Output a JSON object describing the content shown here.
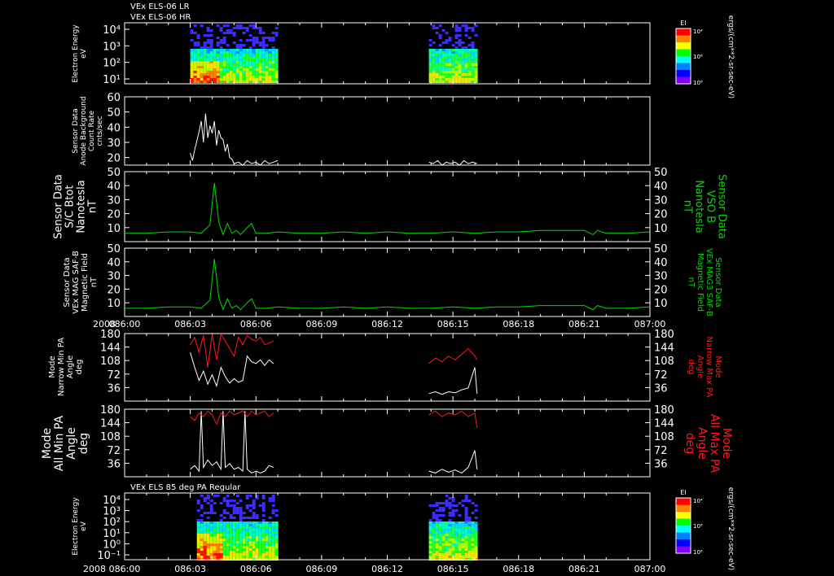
{
  "header": {
    "line1": "VEx ELS-06 LR",
    "line2": "VEx ELS-06 HR",
    "bottom_title": "VEx ELS 85 deg PA Regular"
  },
  "colors": {
    "background": "#000000",
    "axis": "#ffffff",
    "white_trace": "#ffffff",
    "green_trace": "#00dd00",
    "red_trace": "#ff1a1a"
  },
  "time_axis": {
    "year_label": "2008",
    "ticks": [
      "086:00",
      "086:03",
      "086:06",
      "086:09",
      "086:12",
      "086:15",
      "086:18",
      "086:21",
      "087:00"
    ],
    "range_hours": [
      0,
      24
    ]
  },
  "panels": [
    {
      "id": "spec1",
      "ylabel": [
        "Electron Energy",
        "eV"
      ]
    },
    {
      "id": "bg",
      "ylabel": [
        "Sensor Data",
        "Anode Background",
        "Count Rate",
        "cnts/sec"
      ]
    },
    {
      "id": "bvso",
      "ylabel": [
        "Sensor Data",
        "S/C Btot",
        "Nanotesla",
        "nT"
      ],
      "rlabel": [
        "Sensor Data",
        "VSO B",
        "Nanotesla",
        "nT"
      ]
    },
    {
      "id": "bmag",
      "ylabel": [
        "Sensor Data",
        "VEx MAG SAF-B",
        "Magnetic Field",
        "nT"
      ],
      "rlabel": [
        "Sensor Data",
        "VEx MAG3 SAF-B",
        "Magnetic Field",
        "nT"
      ]
    },
    {
      "id": "narrow",
      "ylabel": [
        "Mode",
        "Narrow Min PA",
        "Angle",
        "deg"
      ],
      "rlabel": [
        "Mode",
        "Narrow Max PA",
        "Angle",
        "deg"
      ]
    },
    {
      "id": "all",
      "ylabel": [
        "Mode",
        "All Min PA",
        "Angle",
        "deg"
      ],
      "rlabel": [
        "Mode",
        "All Max PA",
        "Angle",
        "deg"
      ]
    },
    {
      "id": "spec2",
      "ylabel": [
        "Electron Energy",
        "eV"
      ]
    }
  ],
  "colorbar": {
    "label": "EI",
    "ticks_top": [
      "10⁴",
      "10⁶",
      "10⁸"
    ],
    "units": "ergs/(cm**2-sr-sec-eV)"
  },
  "chart_data": [
    {
      "type": "heatmap",
      "title": "VEx ELS-06 LR / VEx ELS-06 HR",
      "xlabel": "",
      "ylabel": "Electron Energy eV",
      "yscale": "log",
      "ytick_labels": [
        "10⁴",
        "10³",
        "10²",
        "10¹"
      ],
      "data_intervals_hours": [
        [
          3.0,
          7.0
        ],
        [
          13.9,
          16.1
        ]
      ]
    },
    {
      "type": "line",
      "ylabel": "Sensor Data Anode Background Count Rate cnts/sec",
      "ylim": [
        15,
        60
      ],
      "yticks": [
        20,
        30,
        40,
        50,
        60
      ],
      "series": [
        {
          "x": [
            3.0,
            3.1,
            3.2,
            3.3,
            3.4,
            3.5,
            3.6,
            3.7,
            3.8,
            3.9,
            4.0,
            4.1,
            4.2,
            4.3,
            4.4,
            4.5,
            4.6,
            4.7,
            4.8,
            4.9,
            5.0,
            5.2,
            5.4,
            5.6,
            5.8,
            6.0,
            6.2,
            6.4,
            6.6,
            6.8,
            7.0
          ],
          "y": [
            23,
            18,
            25,
            31,
            37,
            44,
            30,
            49,
            33,
            41,
            36,
            44,
            28,
            38,
            33,
            32,
            24,
            29,
            20,
            19,
            16,
            17,
            15,
            18,
            16,
            17,
            15,
            18,
            16,
            17,
            18
          ]
        },
        {
          "x": [
            13.9,
            14.1,
            14.3,
            14.5,
            14.7,
            14.9,
            15.1,
            15.3,
            15.5,
            15.7,
            15.9,
            16.1
          ],
          "y": [
            17,
            16,
            18,
            15,
            17,
            16,
            17,
            15,
            18,
            16,
            17,
            16
          ]
        }
      ]
    },
    {
      "type": "line",
      "ylabel": "Sensor Data S/C Btot Nanotesla nT",
      "ylim": [
        0,
        50
      ],
      "yticks": [
        10,
        20,
        30,
        40,
        50
      ],
      "series": [
        {
          "x": [
            0,
            1,
            2,
            3,
            3.5,
            3.9,
            4.1,
            4.3,
            4.5,
            4.7,
            4.9,
            5.1,
            5.3,
            5.6,
            5.8,
            6.0,
            6.5,
            7,
            8,
            9,
            10,
            11,
            12,
            13,
            14,
            15,
            16,
            17,
            18,
            19,
            20,
            21,
            21.4,
            21.6,
            22,
            23,
            24
          ],
          "y": [
            6,
            6,
            7,
            7,
            6,
            12,
            42,
            14,
            5,
            13,
            6,
            8,
            5,
            10,
            13,
            6,
            6,
            7,
            6,
            6,
            7,
            6,
            7,
            6,
            6,
            7,
            6,
            7,
            7,
            8,
            8,
            8,
            5,
            8,
            6,
            6,
            7
          ]
        }
      ]
    },
    {
      "type": "line",
      "ylabel": "Sensor Data VEx MAG SAF-B Magnetic Field nT",
      "ylim": [
        0,
        50
      ],
      "yticks": [
        10,
        20,
        30,
        40,
        50
      ],
      "series": [
        {
          "x": [
            0,
            1,
            2,
            3,
            3.5,
            3.9,
            4.1,
            4.3,
            4.5,
            4.7,
            4.9,
            5.1,
            5.3,
            5.6,
            5.8,
            6.0,
            6.5,
            7,
            8,
            9,
            10,
            11,
            12,
            13,
            14,
            15,
            16,
            17,
            18,
            19,
            20,
            21,
            21.4,
            21.6,
            22,
            23,
            24
          ],
          "y": [
            6,
            6,
            7,
            7,
            6,
            12,
            42,
            14,
            5,
            13,
            6,
            8,
            5,
            10,
            13,
            6,
            6,
            7,
            6,
            6,
            7,
            6,
            7,
            6,
            6,
            7,
            6,
            7,
            7,
            8,
            8,
            8,
            5,
            8,
            6,
            6,
            7
          ]
        }
      ]
    },
    {
      "type": "line",
      "ylabel": "Mode Narrow Min PA Angle deg",
      "ylim": [
        0,
        180
      ],
      "yticks": [
        36,
        72,
        108,
        144,
        180
      ],
      "series": [
        {
          "name": "Min PA",
          "x": [
            3.0,
            3.2,
            3.4,
            3.6,
            3.8,
            4.0,
            4.2,
            4.4,
            4.6,
            4.8,
            5.0,
            5.2,
            5.4,
            5.6,
            5.8,
            6.0,
            6.2,
            6.4,
            6.6,
            6.8,
            13.9,
            14.2,
            14.5,
            14.8,
            15.1,
            15.4,
            15.7,
            16.0,
            16.1
          ],
          "y": [
            130,
            90,
            55,
            80,
            45,
            70,
            40,
            90,
            65,
            48,
            60,
            50,
            55,
            120,
            105,
            100,
            110,
            95,
            110,
            100,
            20,
            25,
            18,
            25,
            22,
            30,
            35,
            90,
            20
          ]
        },
        {
          "name": "Max PA",
          "x": [
            3.0,
            3.2,
            3.4,
            3.6,
            3.8,
            4.0,
            4.2,
            4.4,
            4.6,
            4.8,
            5.0,
            5.2,
            5.4,
            5.6,
            5.8,
            6.0,
            6.2,
            6.4,
            6.6,
            6.8,
            13.9,
            14.2,
            14.5,
            14.8,
            15.1,
            15.4,
            15.7,
            16.0,
            16.1
          ],
          "y": [
            150,
            170,
            130,
            175,
            90,
            178,
            110,
            178,
            160,
            140,
            120,
            170,
            150,
            175,
            165,
            160,
            170,
            150,
            155,
            160,
            100,
            115,
            105,
            120,
            110,
            125,
            140,
            120,
            110
          ]
        }
      ]
    },
    {
      "type": "line",
      "ylabel": "Mode All Min PA Angle deg",
      "ylim": [
        0,
        180
      ],
      "yticks": [
        36,
        72,
        108,
        144,
        180
      ],
      "series": [
        {
          "name": "Min PA",
          "x": [
            3.0,
            3.2,
            3.4,
            3.5,
            3.6,
            3.8,
            4.0,
            4.2,
            4.4,
            4.5,
            4.6,
            4.8,
            5.0,
            5.2,
            5.4,
            5.5,
            5.6,
            5.8,
            6.0,
            6.2,
            6.4,
            6.6,
            6.8,
            13.9,
            14.2,
            14.5,
            14.8,
            15.1,
            15.4,
            15.7,
            16.0,
            16.1
          ],
          "y": [
            20,
            30,
            15,
            175,
            25,
            45,
            30,
            40,
            20,
            175,
            25,
            35,
            20,
            25,
            15,
            175,
            20,
            10,
            15,
            10,
            15,
            30,
            25,
            15,
            10,
            20,
            12,
            18,
            10,
            25,
            70,
            20
          ]
        },
        {
          "name": "Max PA",
          "x": [
            3.0,
            3.2,
            3.4,
            3.6,
            3.8,
            4.0,
            4.2,
            4.4,
            4.6,
            4.8,
            5.0,
            5.2,
            5.4,
            5.6,
            5.8,
            6.0,
            6.2,
            6.4,
            6.6,
            6.8,
            13.9,
            14.2,
            14.5,
            14.8,
            15.1,
            15.4,
            15.7,
            16.0,
            16.1
          ],
          "y": [
            160,
            150,
            170,
            160,
            175,
            165,
            140,
            170,
            160,
            175,
            165,
            170,
            175,
            160,
            175,
            165,
            170,
            175,
            160,
            170,
            165,
            175,
            160,
            170,
            165,
            175,
            160,
            170,
            130
          ]
        }
      ]
    },
    {
      "type": "heatmap",
      "title": "VEx ELS 85 deg PA Regular",
      "ylabel": "Electron Energy eV",
      "yscale": "log",
      "ytick_labels": [
        "10⁴",
        "10³",
        "10²",
        "10¹",
        "10⁰",
        "10⁻¹"
      ],
      "data_intervals_hours": [
        [
          3.3,
          7.0
        ],
        [
          13.9,
          16.1
        ]
      ]
    }
  ]
}
